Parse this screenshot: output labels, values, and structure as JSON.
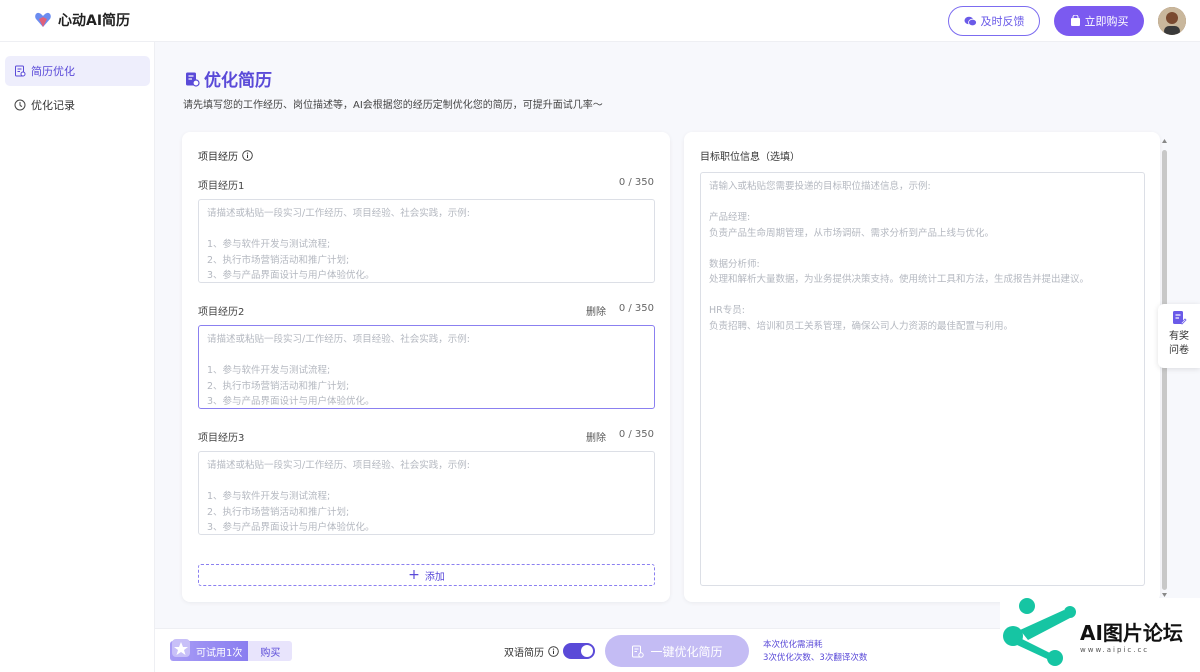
{
  "app": {
    "title": "心动AI简历"
  },
  "header": {
    "feedback_label": "及时反馈",
    "buy_label": "立即购买"
  },
  "sidebar": {
    "items": [
      {
        "label": "简历优化",
        "icon": "resume-icon"
      },
      {
        "label": "优化记录",
        "icon": "history-icon"
      }
    ]
  },
  "page": {
    "title": "优化简历",
    "description": "请先填写您的工作经历、岗位描述等，AI会根据您的经历定制优化您的简历，可提升面试几率～"
  },
  "projects": {
    "section_label": "项目经历",
    "delete_label": "删除",
    "placeholder": "请描述或粘贴一段实习/工作经历、项目经验、社会实践，示例:\n\n1、参与软件开发与测试流程;\n2、执行市场营销活动和推广计划;\n3、参与产品界面设计与用户体验优化。",
    "items": [
      {
        "label": "项目经历1",
        "counter": "0 / 350"
      },
      {
        "label": "项目经历2",
        "counter": "0 / 350"
      },
      {
        "label": "项目经历3",
        "counter": "0 / 350"
      }
    ],
    "add_label": "添加"
  },
  "target": {
    "label": "目标职位信息（选填）",
    "placeholder": "请输入或粘贴您需要投递的目标职位描述信息，示例:\n\n产品经理:\n负责产品生命周期管理，从市场调研、需求分析到产品上线与优化。\n\n数据分析师:\n处理和解析大量数据，为业务提供决策支持。使用统计工具和方法，生成报告并提出建议。\n\nHR专员:\n负责招聘、培训和员工关系管理，确保公司人力资源的最佳配置与利用。"
  },
  "survey": {
    "line1": "有奖",
    "line2": "问卷"
  },
  "footer": {
    "trial_label": "可试用1次",
    "trial_buy": "购买",
    "bilingual_label": "双语简历",
    "bilingual_on": true,
    "optimize_label": "一键优化简历",
    "cost_line1": "本次优化需消耗",
    "cost_line2": "3次优化次数、3次翻译次数"
  },
  "watermark": {
    "text": "AI图片论坛",
    "url": "www.aipic.cc"
  },
  "colors": {
    "accent": "#5a4ad8",
    "accent_light": "#c4bcf4",
    "watermark_green": "#16c5a3"
  }
}
